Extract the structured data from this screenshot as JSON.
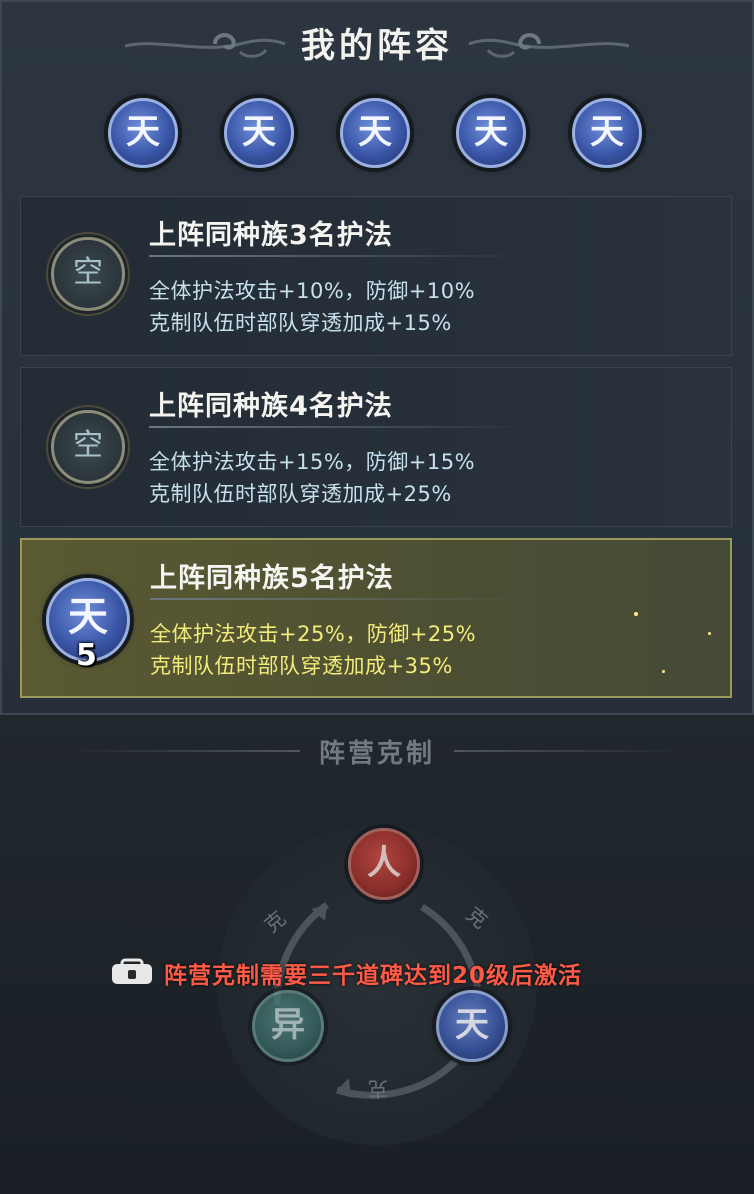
{
  "header": {
    "title": "我的阵容"
  },
  "lineup": {
    "slots": [
      {
        "glyph": "天"
      },
      {
        "glyph": "天"
      },
      {
        "glyph": "天"
      },
      {
        "glyph": "天"
      },
      {
        "glyph": "天"
      }
    ]
  },
  "bonds": [
    {
      "title": "上阵同种族3名护法",
      "slot_glyph": "空",
      "line1": "全体护法攻击+10%，防御+10%",
      "line2": "克制队伍时部队穿透加成+15%",
      "active": false
    },
    {
      "title": "上阵同种族4名护法",
      "slot_glyph": "空",
      "line1": "全体护法攻击+15%，防御+15%",
      "line2": "克制队伍时部队穿透加成+25%",
      "active": false
    },
    {
      "title": "上阵同种族5名护法",
      "slot_glyph": "天",
      "count": "5",
      "line1": "全体护法攻击+25%，防御+25%",
      "line2": "克制队伍时部队穿透加成+35%",
      "active": true
    }
  ],
  "counter_section": {
    "title": "阵营克制",
    "factions": {
      "top": "人",
      "right": "天",
      "left": "异"
    },
    "arrow_labels": {
      "right": "克",
      "left": "克",
      "bottom": "克"
    },
    "lock_message": "阵营克制需要三千道碑达到20级后激活"
  },
  "colors": {
    "panel": "#2a333d",
    "active_bond_bg": "#55562f",
    "active_text": "#f2ec7a",
    "inactive_text": "#c7e0ee",
    "lock_text": "#ff5a45",
    "tian_blue": "#3b56a8",
    "ren_red": "#9c2f2b",
    "yi_teal": "#3a6e6a"
  }
}
